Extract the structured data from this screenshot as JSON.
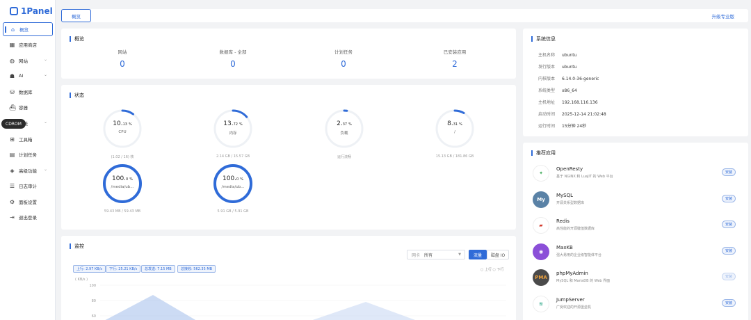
{
  "brand": {
    "name": "1Panel"
  },
  "sidebar": {
    "items": [
      {
        "label": "概览",
        "icon": "home-icon",
        "glyph": "⌂",
        "has_children": false,
        "active": true
      },
      {
        "label": "应用商店",
        "icon": "app-store-icon",
        "glyph": "▦",
        "has_children": false
      },
      {
        "label": "网站",
        "icon": "globe-icon",
        "glyph": "◍",
        "has_children": true
      },
      {
        "label": "AI",
        "icon": "robot-icon",
        "glyph": "☗",
        "has_children": true
      },
      {
        "label": "数据库",
        "icon": "database-icon",
        "glyph": "⛁",
        "has_children": false
      },
      {
        "label": "容器",
        "icon": "container-icon",
        "glyph": "⛴",
        "has_children": false
      },
      {
        "label": "系统",
        "icon": "system-icon",
        "glyph": "◎",
        "has_children": true
      },
      {
        "label": "工具箱",
        "icon": "toolbox-icon",
        "glyph": "⊞",
        "has_children": false
      },
      {
        "label": "计划任务",
        "icon": "calendar-icon",
        "glyph": "▤",
        "has_children": false
      },
      {
        "label": "高级功能",
        "icon": "diamond-icon",
        "glyph": "◈",
        "has_children": true
      },
      {
        "label": "日志审计",
        "icon": "log-icon",
        "glyph": "☰",
        "has_children": false
      },
      {
        "label": "面板设置",
        "icon": "settings-icon",
        "glyph": "⚙",
        "has_children": false
      },
      {
        "label": "退出登录",
        "icon": "logout-icon",
        "glyph": "⇥",
        "has_children": false
      }
    ],
    "tooltip": "CDROM"
  },
  "topbar": {
    "tab": "概览",
    "upgrade": "升级专业版"
  },
  "overview": {
    "title": "概览",
    "stats": [
      {
        "label": "网站",
        "value": "0"
      },
      {
        "label": "数据库 - 全部",
        "value": "0"
      },
      {
        "label": "计划任务",
        "value": "0"
      },
      {
        "label": "已安装应用",
        "value": "2"
      }
    ]
  },
  "status": {
    "title": "状态",
    "gauges": [
      {
        "value": "10.",
        "decimal": "13",
        "unit": "%",
        "percent": 10.13,
        "label": "CPU",
        "sub": "(1.02 / 16) 核"
      },
      {
        "value": "13.",
        "decimal": "72",
        "unit": "%",
        "percent": 13.72,
        "label": "内存",
        "sub": "2.14 GB / 15.57 GB"
      },
      {
        "value": "2.",
        "decimal": "37",
        "unit": "%",
        "percent": 2.37,
        "label": "负载",
        "sub": "运行流畅"
      },
      {
        "value": "8.",
        "decimal": "31",
        "unit": "%",
        "percent": 8.31,
        "label": "/",
        "sub": "15.13 GB / 181.86 GB"
      },
      {
        "value": "100.",
        "decimal": "0",
        "unit": "%",
        "percent": 100,
        "label": "/media/ub...",
        "sub": "59.43 MB / 59.43 MB"
      },
      {
        "value": "100.",
        "decimal": "0",
        "unit": "%",
        "percent": 100,
        "label": "/media/ub...",
        "sub": "5.91 GB / 5.91 GB"
      }
    ]
  },
  "monitor": {
    "title": "监控",
    "select_prefix": "网卡",
    "select_value": "所有",
    "btn_traffic": "流量",
    "btn_disk": "磁盘 IO",
    "chips": [
      "上行: 2.97 KB/s",
      "下行: 25.21 KB/s",
      "总发送: 7.15 MB",
      "总接收: 562.35 MB"
    ],
    "legend": "○ 上行  ○ 下行",
    "unit": "( KB/s )"
  },
  "chart_data": {
    "type": "area",
    "title": "",
    "ylabel": "( KB/s )",
    "y_ticks": [
      100,
      80,
      60
    ],
    "ylim": [
      0,
      100
    ],
    "series": [
      {
        "name": "上行",
        "color": "#8fb0e6",
        "values": []
      },
      {
        "name": "下行",
        "color": "#b8cdf0",
        "values": []
      }
    ]
  },
  "sysinfo": {
    "title": "系统信息",
    "rows": [
      {
        "k": "主机名称",
        "v": "ubuntu"
      },
      {
        "k": "发行版本",
        "v": "ubuntu"
      },
      {
        "k": "内核版本",
        "v": "6.14.0-36-generic"
      },
      {
        "k": "系统类型",
        "v": "x86_64"
      },
      {
        "k": "主机地址",
        "v": "192.168.116.136"
      },
      {
        "k": "启动时间",
        "v": "2025-12-14 21:02:48"
      },
      {
        "k": "运行时间",
        "v": "15分钟 24秒"
      }
    ]
  },
  "apps": {
    "title": "推荐应用",
    "install_label": "安装",
    "items": [
      {
        "name": "OpenResty",
        "desc": "基于 NGINX 和 LuaJIT 的 Web 平台",
        "icon": "openresty-icon",
        "glyph": "✦",
        "bg": "#ffffff",
        "fg": "#3aa856"
      },
      {
        "name": "MySQL",
        "desc": "开源关系型数据库",
        "icon": "mysql-icon",
        "glyph": "My",
        "bg": "#5a82a6",
        "fg": "#ffffff"
      },
      {
        "name": "Redis",
        "desc": "高性能的开源键值数据库",
        "icon": "redis-icon",
        "glyph": "▰",
        "bg": "#ffffff",
        "fg": "#d33a2c"
      },
      {
        "name": "MaxKB",
        "desc": "强大易用的企业级智能体平台",
        "icon": "maxkb-icon",
        "glyph": "◉",
        "bg": "#8b4fd8",
        "fg": "#ffffff"
      },
      {
        "name": "phpMyAdmin",
        "desc": "MySQL 和 MariaDB 的 Web 界面",
        "icon": "phpmyadmin-icon",
        "glyph": "PMA",
        "bg": "#4a4a4a",
        "fg": "#f0a23a"
      },
      {
        "name": "JumpServer",
        "desc": "广受欢迎的开源堡垒机",
        "icon": "jumpserver-icon",
        "glyph": "≋",
        "bg": "#ffffff",
        "fg": "#2fa889"
      }
    ]
  }
}
